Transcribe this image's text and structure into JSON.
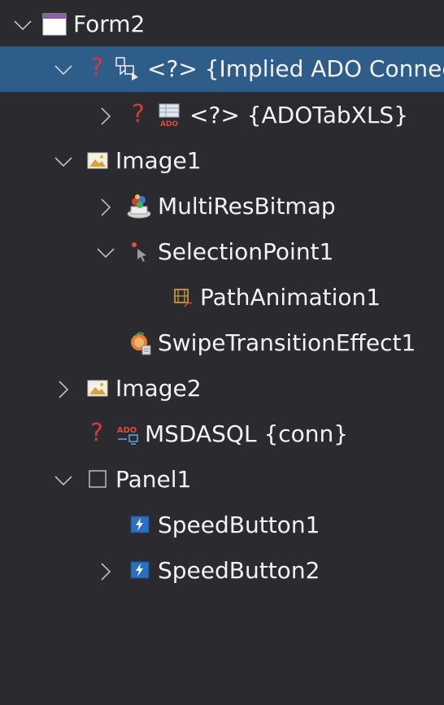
{
  "tree": {
    "rows": [
      {
        "label": "Form2",
        "expanded": true,
        "selected": false,
        "icon": "form-icon"
      },
      {
        "label": "<?> {Implied ADO Connec",
        "expanded": true,
        "selected": true,
        "icon": "ado-connection-icon",
        "unknown": true
      },
      {
        "label": "<?> {ADOTabXLS}",
        "expanded": false,
        "selected": false,
        "icon": "ado-table-icon",
        "unknown": true
      },
      {
        "label": "Image1",
        "expanded": true,
        "selected": false,
        "icon": "image-icon"
      },
      {
        "label": "MultiResBitmap",
        "expanded": false,
        "selected": false,
        "icon": "multires-bitmap-icon"
      },
      {
        "label": "SelectionPoint1",
        "expanded": true,
        "selected": false,
        "icon": "selection-point-icon"
      },
      {
        "label": "PathAnimation1",
        "selected": false,
        "icon": "path-animation-icon"
      },
      {
        "label": "SwipeTransitionEffect1",
        "selected": false,
        "icon": "transition-effect-icon"
      },
      {
        "label": "Image2",
        "expanded": false,
        "selected": false,
        "icon": "image-icon"
      },
      {
        "label": "MSDASQL {conn}",
        "selected": false,
        "icon": "ado-connection-small-icon",
        "unknown": true
      },
      {
        "label": "Panel1",
        "expanded": true,
        "selected": false,
        "icon": "panel-icon"
      },
      {
        "label": "SpeedButton1",
        "selected": false,
        "icon": "speed-button-icon"
      },
      {
        "label": "SpeedButton2",
        "expanded": false,
        "selected": false,
        "icon": "speed-button-icon"
      }
    ],
    "unknown_mark": "?",
    "colors": {
      "background": "#2b2b2f",
      "selection": "#2f5d8a",
      "text": "#f2f2f2",
      "chevron": "#bfbfbf",
      "unknown": "#d23a3a"
    }
  }
}
